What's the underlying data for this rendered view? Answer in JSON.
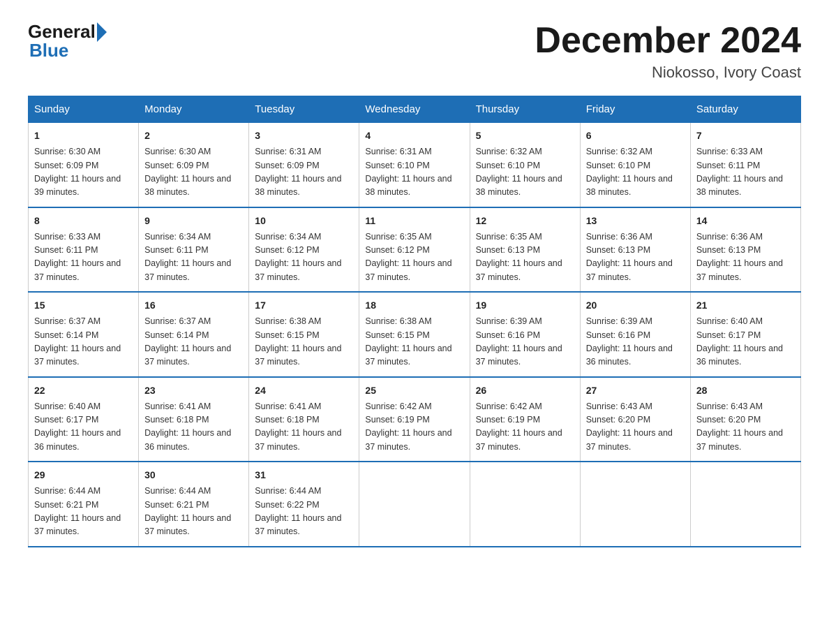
{
  "logo": {
    "general": "General",
    "blue": "Blue"
  },
  "header": {
    "month_title": "December 2024",
    "location": "Niokosso, Ivory Coast"
  },
  "days_of_week": [
    "Sunday",
    "Monday",
    "Tuesday",
    "Wednesday",
    "Thursday",
    "Friday",
    "Saturday"
  ],
  "weeks": [
    [
      {
        "day": "1",
        "sunrise": "6:30 AM",
        "sunset": "6:09 PM",
        "daylight": "11 hours and 39 minutes."
      },
      {
        "day": "2",
        "sunrise": "6:30 AM",
        "sunset": "6:09 PM",
        "daylight": "11 hours and 38 minutes."
      },
      {
        "day": "3",
        "sunrise": "6:31 AM",
        "sunset": "6:09 PM",
        "daylight": "11 hours and 38 minutes."
      },
      {
        "day": "4",
        "sunrise": "6:31 AM",
        "sunset": "6:10 PM",
        "daylight": "11 hours and 38 minutes."
      },
      {
        "day": "5",
        "sunrise": "6:32 AM",
        "sunset": "6:10 PM",
        "daylight": "11 hours and 38 minutes."
      },
      {
        "day": "6",
        "sunrise": "6:32 AM",
        "sunset": "6:10 PM",
        "daylight": "11 hours and 38 minutes."
      },
      {
        "day": "7",
        "sunrise": "6:33 AM",
        "sunset": "6:11 PM",
        "daylight": "11 hours and 38 minutes."
      }
    ],
    [
      {
        "day": "8",
        "sunrise": "6:33 AM",
        "sunset": "6:11 PM",
        "daylight": "11 hours and 37 minutes."
      },
      {
        "day": "9",
        "sunrise": "6:34 AM",
        "sunset": "6:11 PM",
        "daylight": "11 hours and 37 minutes."
      },
      {
        "day": "10",
        "sunrise": "6:34 AM",
        "sunset": "6:12 PM",
        "daylight": "11 hours and 37 minutes."
      },
      {
        "day": "11",
        "sunrise": "6:35 AM",
        "sunset": "6:12 PM",
        "daylight": "11 hours and 37 minutes."
      },
      {
        "day": "12",
        "sunrise": "6:35 AM",
        "sunset": "6:13 PM",
        "daylight": "11 hours and 37 minutes."
      },
      {
        "day": "13",
        "sunrise": "6:36 AM",
        "sunset": "6:13 PM",
        "daylight": "11 hours and 37 minutes."
      },
      {
        "day": "14",
        "sunrise": "6:36 AM",
        "sunset": "6:13 PM",
        "daylight": "11 hours and 37 minutes."
      }
    ],
    [
      {
        "day": "15",
        "sunrise": "6:37 AM",
        "sunset": "6:14 PM",
        "daylight": "11 hours and 37 minutes."
      },
      {
        "day": "16",
        "sunrise": "6:37 AM",
        "sunset": "6:14 PM",
        "daylight": "11 hours and 37 minutes."
      },
      {
        "day": "17",
        "sunrise": "6:38 AM",
        "sunset": "6:15 PM",
        "daylight": "11 hours and 37 minutes."
      },
      {
        "day": "18",
        "sunrise": "6:38 AM",
        "sunset": "6:15 PM",
        "daylight": "11 hours and 37 minutes."
      },
      {
        "day": "19",
        "sunrise": "6:39 AM",
        "sunset": "6:16 PM",
        "daylight": "11 hours and 37 minutes."
      },
      {
        "day": "20",
        "sunrise": "6:39 AM",
        "sunset": "6:16 PM",
        "daylight": "11 hours and 36 minutes."
      },
      {
        "day": "21",
        "sunrise": "6:40 AM",
        "sunset": "6:17 PM",
        "daylight": "11 hours and 36 minutes."
      }
    ],
    [
      {
        "day": "22",
        "sunrise": "6:40 AM",
        "sunset": "6:17 PM",
        "daylight": "11 hours and 36 minutes."
      },
      {
        "day": "23",
        "sunrise": "6:41 AM",
        "sunset": "6:18 PM",
        "daylight": "11 hours and 36 minutes."
      },
      {
        "day": "24",
        "sunrise": "6:41 AM",
        "sunset": "6:18 PM",
        "daylight": "11 hours and 37 minutes."
      },
      {
        "day": "25",
        "sunrise": "6:42 AM",
        "sunset": "6:19 PM",
        "daylight": "11 hours and 37 minutes."
      },
      {
        "day": "26",
        "sunrise": "6:42 AM",
        "sunset": "6:19 PM",
        "daylight": "11 hours and 37 minutes."
      },
      {
        "day": "27",
        "sunrise": "6:43 AM",
        "sunset": "6:20 PM",
        "daylight": "11 hours and 37 minutes."
      },
      {
        "day": "28",
        "sunrise": "6:43 AM",
        "sunset": "6:20 PM",
        "daylight": "11 hours and 37 minutes."
      }
    ],
    [
      {
        "day": "29",
        "sunrise": "6:44 AM",
        "sunset": "6:21 PM",
        "daylight": "11 hours and 37 minutes."
      },
      {
        "day": "30",
        "sunrise": "6:44 AM",
        "sunset": "6:21 PM",
        "daylight": "11 hours and 37 minutes."
      },
      {
        "day": "31",
        "sunrise": "6:44 AM",
        "sunset": "6:22 PM",
        "daylight": "11 hours and 37 minutes."
      },
      null,
      null,
      null,
      null
    ]
  ]
}
